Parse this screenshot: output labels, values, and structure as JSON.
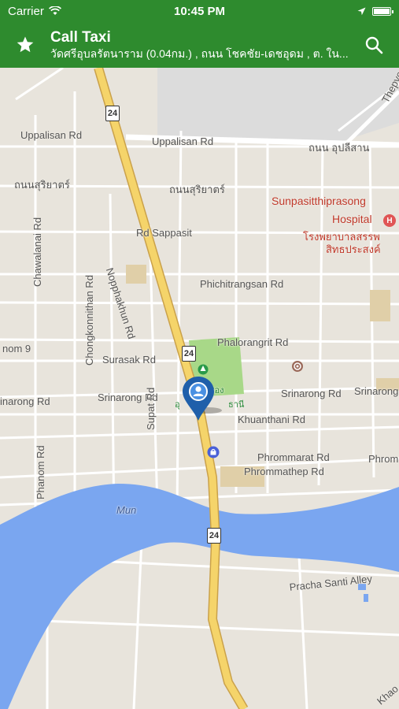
{
  "status_bar": {
    "carrier": "Carrier",
    "time": "10:45 PM"
  },
  "header": {
    "title": "Call Taxi",
    "subtitle": "วัดศรีอุบลรัตนาราม (0.04กม.) , ถนน โชคชัย-เดชอุดม , ต. ใน...",
    "icons": [
      "star-icon",
      "search-icon"
    ],
    "bar_color": "#2e8b2e"
  },
  "map": {
    "roads": {
      "uppalisan_left": "Uppalisan Rd",
      "uppalisan_right": "Uppalisan Rd",
      "uppalisan_th": "ถนน อุปลีสาน",
      "thepyothi": "Thepyo",
      "surijart_left": "ถนนสุริยาตร์",
      "surijart_center": "ถนนสุริยาตร์",
      "nopphakhun": "Nopphakhun Rd",
      "sappasit": "Rd Sappasit",
      "chawalanai": "Chawalanai Rd",
      "chongkonnithan": "Chongkonnithan Rd",
      "phichitrangsan": "Phichitrangsan Rd",
      "phalorangrit": "Phalorangrit Rd",
      "nom": "nom 9",
      "surasak": "Surasak Rd",
      "srinarong_left": "inarong Rd",
      "srinarong_center": "Srinarong Rd",
      "srinarong_right": "Srinarong Rd",
      "srinarong_far": "Srinarong",
      "khuanthani": "Khuanthani Rd",
      "supat": "Supat Rd",
      "phanom": "Phanom Rd",
      "phrommarat": "Phrommarat Rd",
      "phrommathep": "Phrommathep Rd",
      "phrom_far": "Phrom",
      "prachasanti": "Pracha Santi Alley",
      "khao": "Khao",
      "river": "Mun",
      "park_fragment": "อุ",
      "park_fragment2": "ธานี",
      "park_fragment3": "ชอง"
    },
    "highway_number": "24",
    "hospital": {
      "name_line1": "Sunpasitthiprasong",
      "name_line2": "Hospital",
      "thai_line1": "โรงพยาบาลสรรพ",
      "thai_line2": "สิทธประสงค์",
      "badge": "H"
    },
    "colors": {
      "land": "#e8e4dc",
      "water": "#7aa6f0",
      "highway": "#f5d46a",
      "park": "#a8d888",
      "pin": "#1f5faa"
    }
  }
}
